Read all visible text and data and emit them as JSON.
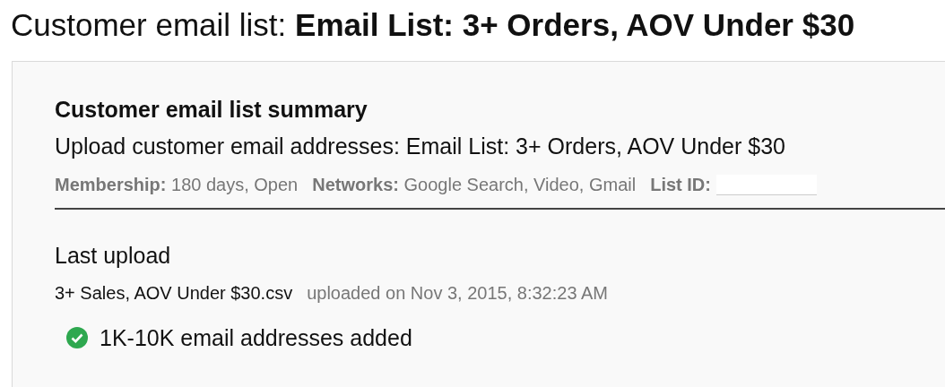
{
  "page_title": {
    "prefix": "Customer email list:",
    "name": "Email List: 3+ Orders, AOV Under $30"
  },
  "summary": {
    "heading": "Customer email list summary",
    "upload_line": "Upload customer email addresses: Email List: 3+ Orders, AOV Under $30",
    "meta": [
      {
        "kind": "text",
        "label": "Membership:",
        "value": "180 days, Open"
      },
      {
        "kind": "text",
        "label": "Networks:",
        "value": "Google Search, Video, Gmail"
      },
      {
        "kind": "redacted",
        "label": "List ID:"
      }
    ]
  },
  "last_upload": {
    "heading": "Last upload",
    "file_name": "3+ Sales, AOV Under $30.csv",
    "uploaded": "uploaded on Nov 3, 2015, 8:32:23 AM",
    "result": {
      "success": true,
      "text": "1K-10K email addresses added"
    }
  }
}
